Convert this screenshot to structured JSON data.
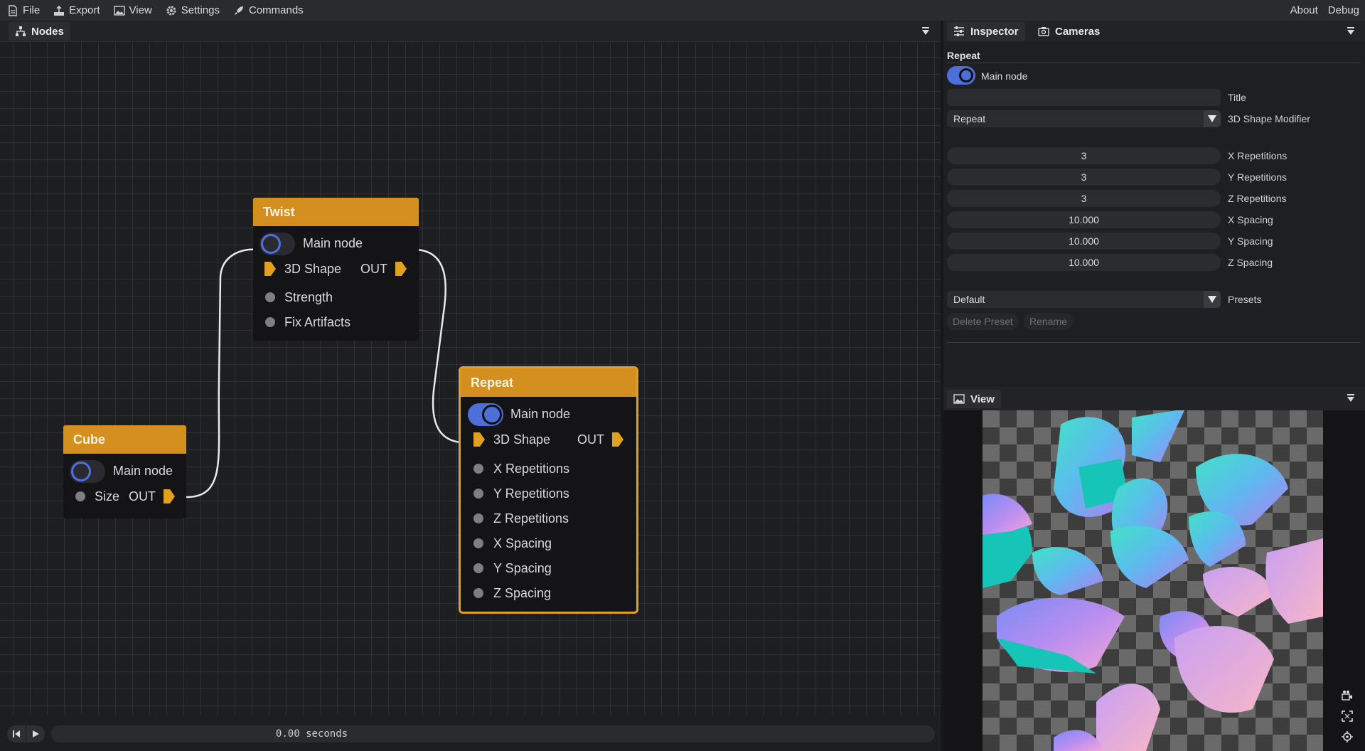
{
  "menubar": {
    "file": "File",
    "export": "Export",
    "view": "View",
    "settings": "Settings",
    "commands": "Commands",
    "about": "About",
    "debug": "Debug"
  },
  "nodes_panel": {
    "tab_label": "Nodes",
    "nodes": {
      "twist": {
        "title": "Twist",
        "main_node": "Main node",
        "main_node_on": false,
        "input_shape": "3D Shape",
        "out": "OUT",
        "strength": "Strength",
        "fix_artifacts": "Fix Artifacts"
      },
      "cube": {
        "title": "Cube",
        "main_node": "Main node",
        "main_node_on": false,
        "size": "Size",
        "out": "OUT"
      },
      "repeat": {
        "title": "Repeat",
        "main_node": "Main node",
        "main_node_on": true,
        "input_shape": "3D Shape",
        "out": "OUT",
        "inputs": [
          "X Repetitions",
          "Y Repetitions",
          "Z Repetitions",
          "X Spacing",
          "Y Spacing",
          "Z Spacing"
        ]
      }
    }
  },
  "timeline": {
    "time": "0.00 seconds"
  },
  "inspector": {
    "tab_inspector": "Inspector",
    "tab_cameras": "Cameras",
    "heading": "Repeat",
    "main_node_label": "Main node",
    "main_node_on": true,
    "title_value": "",
    "title_label": "Title",
    "modifier_value": "Repeat",
    "modifier_label": "3D Shape Modifier",
    "params": [
      {
        "value": "3",
        "label": "X Repetitions"
      },
      {
        "value": "3",
        "label": "Y Repetitions"
      },
      {
        "value": "3",
        "label": "Z Repetitions"
      },
      {
        "value": "10.000",
        "label": "X Spacing"
      },
      {
        "value": "10.000",
        "label": "Y Spacing"
      },
      {
        "value": "10.000",
        "label": "Z Spacing"
      }
    ],
    "preset_value": "Default",
    "preset_label": "Presets",
    "delete_preset": "Delete Preset",
    "rename": "Rename"
  },
  "view_panel": {
    "tab_label": "View"
  },
  "colors": {
    "node_header": "#d4901f",
    "toggle_on": "#4c6fd9",
    "selection": "#dea02a"
  }
}
